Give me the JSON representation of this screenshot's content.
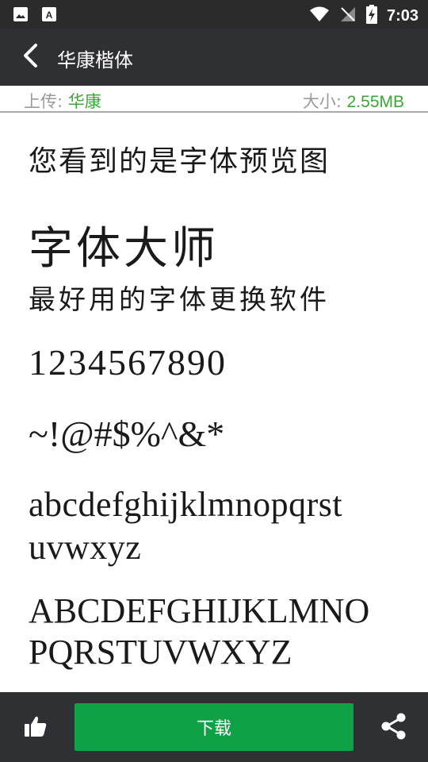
{
  "status_bar": {
    "time": "7:03",
    "icons": [
      "image-icon",
      "font-app-icon",
      "wifi-icon",
      "signal-icon",
      "battery-charging-icon"
    ]
  },
  "app_bar": {
    "title": "华康楷体",
    "back_icon": "chevron-left-icon"
  },
  "info": {
    "uploader_label": "上传: ",
    "uploader_value": "华康",
    "size_label": "大小: ",
    "size_value": "2.55MB"
  },
  "preview": {
    "lines": [
      "您看到的是字体预览图",
      "字体大师",
      "最好用的字体更换软件",
      "1234567890",
      "~!@#$%^&*",
      "abcdefghijklmnopqrst",
      "uvwxyz",
      "ABCDEFGHIJKLMNO",
      "PQRSTUVWXYZ"
    ]
  },
  "bottom_bar": {
    "download_label": "下载",
    "like_icon": "thumbs-up-icon",
    "share_icon": "share-icon"
  },
  "colors": {
    "app_bar": "#2f3033",
    "accent_green": "#3aa832",
    "download_green": "#0fa146"
  }
}
